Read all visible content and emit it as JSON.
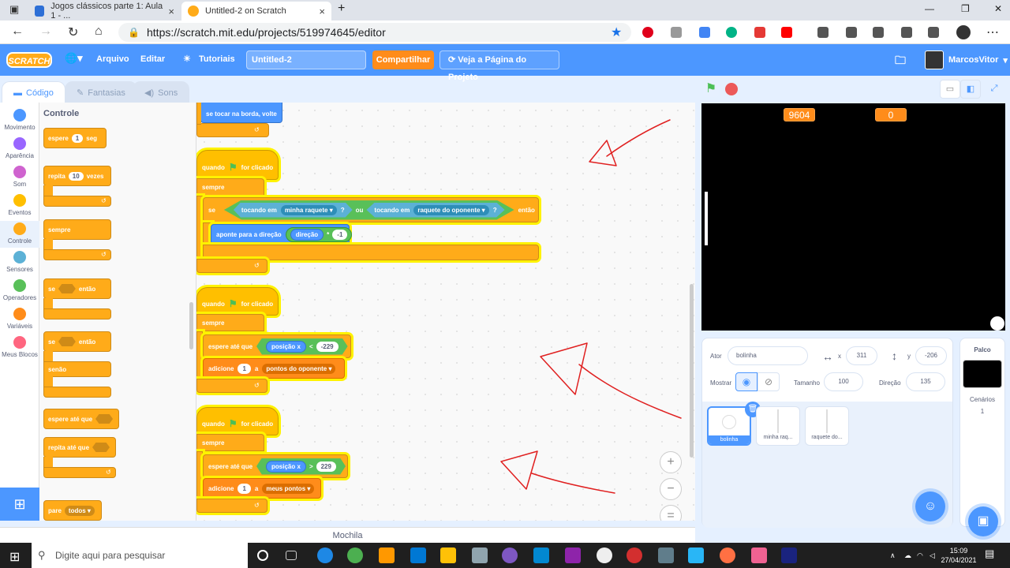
{
  "browser": {
    "tabs": [
      {
        "title": "Jogos clássicos parte 1: Aula 1 - ..."
      },
      {
        "title": "Untitled-2 on Scratch"
      }
    ],
    "new_tab": "+",
    "url": "https://scratch.mit.edu/projects/519974645/editor"
  },
  "menu": {
    "logo": "SCRATCH",
    "file": "Arquivo",
    "edit": "Editar",
    "tutorials": "Tutoriais",
    "project_title": "Untitled-2",
    "share": "Compartilhar",
    "see_project": "Veja a Página do Projeto",
    "username": "MarcosVitor"
  },
  "editor_tabs": {
    "code": "Código",
    "costumes": "Fantasias",
    "sounds": "Sons"
  },
  "categories": [
    {
      "label": "Movimento",
      "color": "#4c97ff"
    },
    {
      "label": "Aparência",
      "color": "#9966ff"
    },
    {
      "label": "Som",
      "color": "#cf63cf"
    },
    {
      "label": "Eventos",
      "color": "#ffbf00"
    },
    {
      "label": "Controle",
      "color": "#ffab19"
    },
    {
      "label": "Sensores",
      "color": "#5cb1d6"
    },
    {
      "label": "Operadores",
      "color": "#59c059"
    },
    {
      "label": "Variáveis",
      "color": "#ff8c1a"
    },
    {
      "label": "Meus Blocos",
      "color": "#ff6680"
    }
  ],
  "palette": {
    "title": "Controle",
    "wait": "espere",
    "wait_value": "1",
    "wait_unit": "seg",
    "repeat": "repita",
    "repeat_value": "10",
    "repeat_unit": "vezes",
    "forever": "sempre",
    "if": "se",
    "then": "então",
    "if2": "se",
    "then2": "então",
    "else": "senão",
    "wait_until": "espere até que",
    "repeat_until": "repita até que",
    "stop": "pare",
    "stop_option": "todos"
  },
  "scripts": {
    "partial_block": "se tocar na borda, volte",
    "s1": {
      "hat": "quando",
      "hat_after": "for clicado",
      "forever": "sempre",
      "if": "se",
      "touching1": "tocando em",
      "target1": "minha raquete",
      "q1": "?",
      "or": "ou",
      "touching2": "tocando em",
      "target2": "raquete do oponente",
      "q2": "?",
      "then": "então",
      "point": "aponte para a direção",
      "direction": "direção",
      "times": "*",
      "value": "-1"
    },
    "s2": {
      "hat": "quando",
      "hat_after": "for clicado",
      "forever": "sempre",
      "wait_until": "espere até que",
      "xpos": "posição x",
      "op": "<",
      "value": "-229",
      "add": "adicione",
      "add_value": "1",
      "a": "a",
      "var": "pontos do oponente"
    },
    "s3": {
      "hat": "quando",
      "hat_after": "for clicado",
      "forever": "sempre",
      "wait_until": "espere até que",
      "xpos": "posição x",
      "op": ">",
      "value": "229",
      "add": "adicione",
      "add_value": "1",
      "a": "a",
      "var": "meus pontos"
    }
  },
  "zoom": {
    "in": "+",
    "out": "−",
    "reset": "="
  },
  "backpack": "Mochila",
  "stage": {
    "score_left": "9604",
    "score_right": "0"
  },
  "sprite_info": {
    "actor_label": "Ator",
    "actor_name": "bolinha",
    "x_label": "x",
    "x": "311",
    "y_label": "y",
    "y": "-206",
    "show_label": "Mostrar",
    "size_label": "Tamanho",
    "size": "100",
    "direction_label": "Direção",
    "direction": "135"
  },
  "sprites": [
    {
      "name": "bolinha"
    },
    {
      "name": "minha raq..."
    },
    {
      "name": "raquete do..."
    }
  ],
  "stage_pane": {
    "title": "Palco",
    "backdrops_label": "Cenários",
    "backdrops_count": "1"
  },
  "taskbar": {
    "search_placeholder": "Digite aqui para pesquisar",
    "time": "15:09",
    "date": "27/04/2021"
  },
  "annotation_color": "#e02020"
}
